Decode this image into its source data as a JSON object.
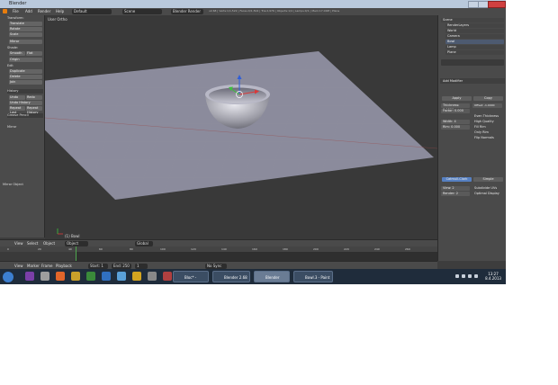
{
  "window": {
    "title": "Blender"
  },
  "menubar": {
    "items": [
      "File",
      "Add",
      "Render",
      "Help"
    ],
    "layout": "Default",
    "scene": "Scene",
    "engine": "Blender Render",
    "stats": "v2.68 | Verts:1/1,522 | Faces:0/1,504 | Tris:2,976 | Objects:1/4 | Lamps:0/1 | Mem:17.00M | Plane"
  },
  "toolshelf": {
    "transform_header": "Transform:",
    "buttons": [
      "Translate",
      "Rotate",
      "Scale",
      "Mirror",
      "Shade:",
      "Smooth",
      "Flat",
      "Origin",
      "Edit",
      "Duplicate",
      "Delete",
      "Join"
    ],
    "history_header": "History",
    "history_buttons": [
      "Undo",
      "Redo",
      "Undo History",
      "Repeat Last",
      "Repeat History"
    ],
    "grease_header": "Grease Pencil",
    "operator_header": "Mirror",
    "bottom_label": "Mirror Object"
  },
  "viewport": {
    "label": "User Ortho",
    "object_label": "(1) Bowl"
  },
  "props": {
    "outliner_items": [
      "Scene",
      "RenderLayers",
      "World",
      "Camera",
      "Bowl",
      "Lamp",
      "Plane"
    ],
    "header": "Add Modifier",
    "tabs": [
      "Apply",
      "Copy"
    ],
    "fields": [
      "Thickness: 0.1000",
      "Offset: -1.0000",
      "Factor: 0.000",
      "Width: 4",
      "Rim: 0.000"
    ],
    "checks": [
      "Even Thickness",
      "High Quality",
      "Fill Rim",
      "Only Rim",
      "Flip Normals"
    ],
    "subsurf": [
      "Catmull-Clark",
      "Simple"
    ],
    "subdiv": [
      "View: 2",
      "Render: 2"
    ],
    "options": [
      "Subdivide UVs",
      "Optimal Display"
    ]
  },
  "vpheader": {
    "items": [
      "View",
      "Select",
      "Object",
      "Object Mode",
      "Global"
    ]
  },
  "timeline": {
    "ticks": [
      "0",
      "20",
      "40",
      "60",
      "80",
      "100",
      "120",
      "140",
      "160",
      "180",
      "200",
      "220",
      "240",
      "260"
    ],
    "current_frame": 1
  },
  "tlheader": {
    "items": [
      "View",
      "Marker",
      "Frame",
      "Playback"
    ],
    "start": "Start: 1",
    "end": "End: 250",
    "frame": "1",
    "keying": "No Sync"
  },
  "taskbar": {
    "tasks": [
      "Bloc* - Untitled...",
      "Blender 2.68 ...",
      "Blender",
      "Bowl.3 - Paint"
    ],
    "time": "13:27",
    "date": "8.4.2013"
  }
}
